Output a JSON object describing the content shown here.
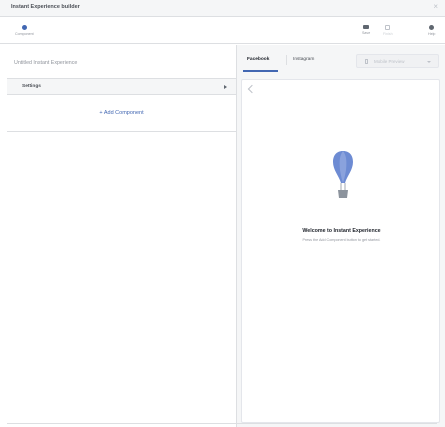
{
  "window": {
    "title": "Instant Experience builder",
    "close_glyph": "×"
  },
  "toolbar": {
    "component": {
      "label": "Component",
      "icon": "component-icon"
    },
    "save": {
      "label": "Save",
      "icon": "save-icon"
    },
    "finish": {
      "label": "Finish",
      "icon": "finish-icon"
    },
    "help": {
      "label": "Help",
      "icon": "help-icon"
    }
  },
  "left_panel": {
    "doc_title": "Untitled Instant Experience",
    "settings_label": "Settings",
    "add_component": "+ Add Component"
  },
  "right_panel": {
    "tabs": [
      {
        "label": "Facebook",
        "active": true
      },
      {
        "label": "Instagram",
        "active": false
      }
    ],
    "preview_mode": "Mobile Preview",
    "welcome_title": "Welcome to Instant Experience",
    "welcome_subtitle": "Press the Add Component button to get started."
  },
  "colors": {
    "accent": "#4267b2",
    "balloon": "#6d8bd3"
  }
}
